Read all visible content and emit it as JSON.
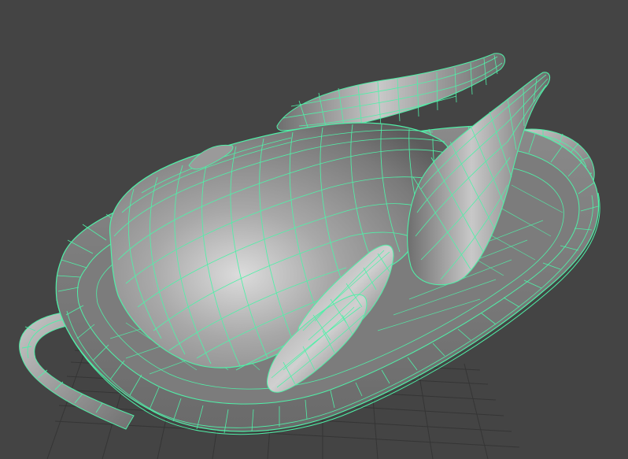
{
  "viewport": {
    "background": "#444444",
    "grid_color": "#343434",
    "wire_color": "#50f0a8",
    "mesh_base_color": "#8e8e8e",
    "mesh_highlight_color": "#d8d8d8",
    "mesh_shadow_color": "#4a4a4a",
    "shading_mode": "smooth-shade-with-wireframe",
    "objects": [
      "roast-turkey-mesh",
      "serving-tray-mesh",
      "tray-handle-left",
      "tray-handle-right"
    ]
  }
}
